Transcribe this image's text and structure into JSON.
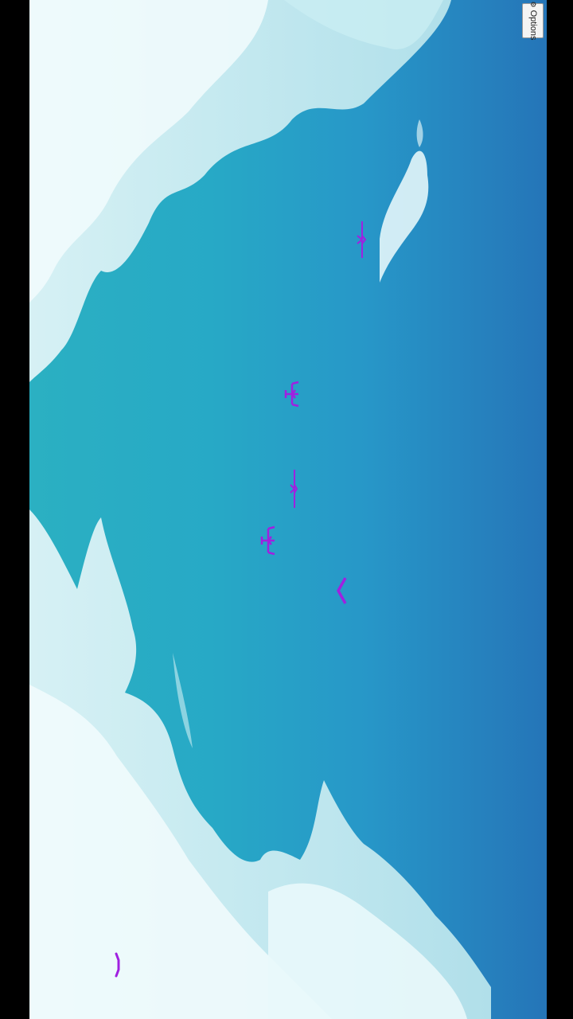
{
  "options_button": {
    "label": "Options",
    "icon": "gear-icon"
  },
  "colors": {
    "sprite": "#a020e0",
    "sky_light": "#2bb0c2",
    "sky_dark": "#2575b8",
    "cloud": "#e8f7fa"
  },
  "sprites": [
    {
      "name": "enemy-fighter-small",
      "icon": "fighter-jet-icon"
    },
    {
      "name": "enemy-fighter",
      "icon": "fighter-jet-icon"
    },
    {
      "name": "enemy-fighter-small",
      "icon": "fighter-jet-icon"
    },
    {
      "name": "enemy-fighter",
      "icon": "fighter-jet-icon"
    },
    {
      "name": "player-ship",
      "icon": "chevron-ship-icon"
    },
    {
      "name": "enemy-bullet",
      "icon": "bullet-icon"
    }
  ]
}
